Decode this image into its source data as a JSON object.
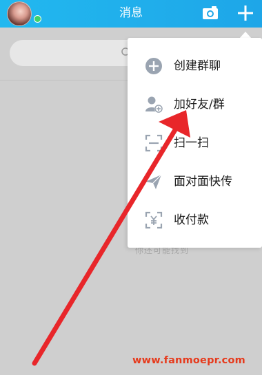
{
  "header": {
    "title": "消息",
    "camera_icon": "camera-icon",
    "plus_icon": "plus-icon"
  },
  "menu": {
    "items": [
      {
        "label": "创建群聊",
        "icon": "group-chat-plus-icon"
      },
      {
        "label": "加好友/群",
        "icon": "add-friend-icon"
      },
      {
        "label": "扫一扫",
        "icon": "scan-icon"
      },
      {
        "label": "面对面快传",
        "icon": "send-plane-icon"
      },
      {
        "label": "收付款",
        "icon": "payment-icon"
      }
    ]
  },
  "background": {
    "faint_text": "你还可能找到"
  },
  "watermark": "www.fanmoepr.com",
  "colors": {
    "header": "#1ea6e8",
    "icon_gray": "#9aa4b1",
    "arrow": "#e8262a",
    "online": "#3ed16a"
  }
}
